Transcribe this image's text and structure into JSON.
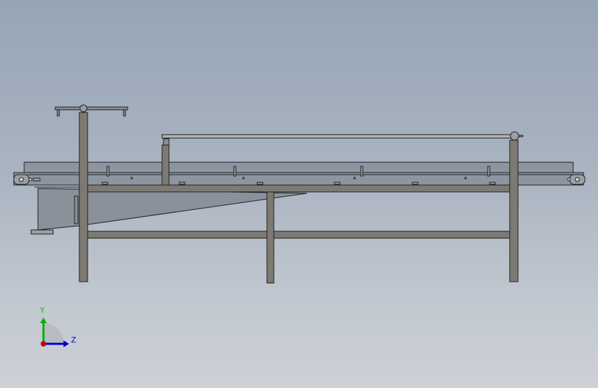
{
  "triad": {
    "y_label": "Y",
    "z_label": "Z",
    "colors": {
      "y": "#00b000",
      "z": "#0000d0",
      "x": "#d00000"
    }
  },
  "model": {
    "frame_color": "#7d7a73",
    "belt_color": "#8d95a0",
    "edge_color": "#1e1e1e"
  }
}
